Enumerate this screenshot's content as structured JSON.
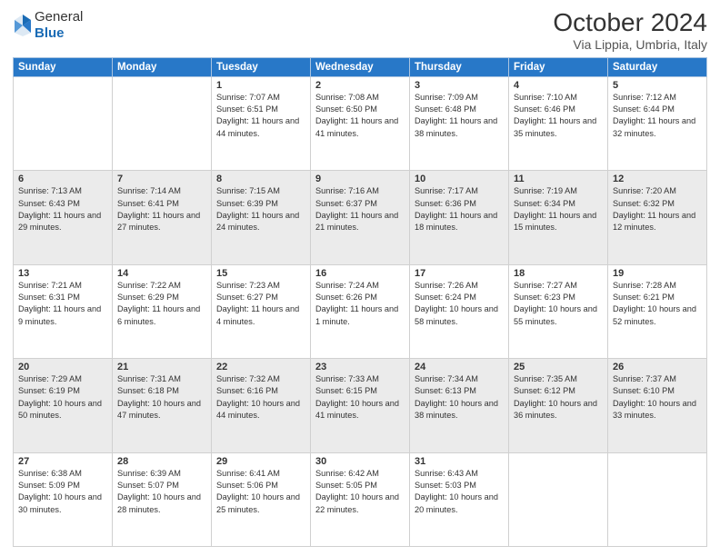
{
  "header": {
    "logo_general": "General",
    "logo_blue": "Blue",
    "title": "October 2024",
    "subtitle": "Via Lippia, Umbria, Italy"
  },
  "weekdays": [
    "Sunday",
    "Monday",
    "Tuesday",
    "Wednesday",
    "Thursday",
    "Friday",
    "Saturday"
  ],
  "weeks": [
    [
      {
        "day": "",
        "detail": ""
      },
      {
        "day": "",
        "detail": ""
      },
      {
        "day": "1",
        "detail": "Sunrise: 7:07 AM\nSunset: 6:51 PM\nDaylight: 11 hours and 44 minutes."
      },
      {
        "day": "2",
        "detail": "Sunrise: 7:08 AM\nSunset: 6:50 PM\nDaylight: 11 hours and 41 minutes."
      },
      {
        "day": "3",
        "detail": "Sunrise: 7:09 AM\nSunset: 6:48 PM\nDaylight: 11 hours and 38 minutes."
      },
      {
        "day": "4",
        "detail": "Sunrise: 7:10 AM\nSunset: 6:46 PM\nDaylight: 11 hours and 35 minutes."
      },
      {
        "day": "5",
        "detail": "Sunrise: 7:12 AM\nSunset: 6:44 PM\nDaylight: 11 hours and 32 minutes."
      }
    ],
    [
      {
        "day": "6",
        "detail": "Sunrise: 7:13 AM\nSunset: 6:43 PM\nDaylight: 11 hours and 29 minutes."
      },
      {
        "day": "7",
        "detail": "Sunrise: 7:14 AM\nSunset: 6:41 PM\nDaylight: 11 hours and 27 minutes."
      },
      {
        "day": "8",
        "detail": "Sunrise: 7:15 AM\nSunset: 6:39 PM\nDaylight: 11 hours and 24 minutes."
      },
      {
        "day": "9",
        "detail": "Sunrise: 7:16 AM\nSunset: 6:37 PM\nDaylight: 11 hours and 21 minutes."
      },
      {
        "day": "10",
        "detail": "Sunrise: 7:17 AM\nSunset: 6:36 PM\nDaylight: 11 hours and 18 minutes."
      },
      {
        "day": "11",
        "detail": "Sunrise: 7:19 AM\nSunset: 6:34 PM\nDaylight: 11 hours and 15 minutes."
      },
      {
        "day": "12",
        "detail": "Sunrise: 7:20 AM\nSunset: 6:32 PM\nDaylight: 11 hours and 12 minutes."
      }
    ],
    [
      {
        "day": "13",
        "detail": "Sunrise: 7:21 AM\nSunset: 6:31 PM\nDaylight: 11 hours and 9 minutes."
      },
      {
        "day": "14",
        "detail": "Sunrise: 7:22 AM\nSunset: 6:29 PM\nDaylight: 11 hours and 6 minutes."
      },
      {
        "day": "15",
        "detail": "Sunrise: 7:23 AM\nSunset: 6:27 PM\nDaylight: 11 hours and 4 minutes."
      },
      {
        "day": "16",
        "detail": "Sunrise: 7:24 AM\nSunset: 6:26 PM\nDaylight: 11 hours and 1 minute."
      },
      {
        "day": "17",
        "detail": "Sunrise: 7:26 AM\nSunset: 6:24 PM\nDaylight: 10 hours and 58 minutes."
      },
      {
        "day": "18",
        "detail": "Sunrise: 7:27 AM\nSunset: 6:23 PM\nDaylight: 10 hours and 55 minutes."
      },
      {
        "day": "19",
        "detail": "Sunrise: 7:28 AM\nSunset: 6:21 PM\nDaylight: 10 hours and 52 minutes."
      }
    ],
    [
      {
        "day": "20",
        "detail": "Sunrise: 7:29 AM\nSunset: 6:19 PM\nDaylight: 10 hours and 50 minutes."
      },
      {
        "day": "21",
        "detail": "Sunrise: 7:31 AM\nSunset: 6:18 PM\nDaylight: 10 hours and 47 minutes."
      },
      {
        "day": "22",
        "detail": "Sunrise: 7:32 AM\nSunset: 6:16 PM\nDaylight: 10 hours and 44 minutes."
      },
      {
        "day": "23",
        "detail": "Sunrise: 7:33 AM\nSunset: 6:15 PM\nDaylight: 10 hours and 41 minutes."
      },
      {
        "day": "24",
        "detail": "Sunrise: 7:34 AM\nSunset: 6:13 PM\nDaylight: 10 hours and 38 minutes."
      },
      {
        "day": "25",
        "detail": "Sunrise: 7:35 AM\nSunset: 6:12 PM\nDaylight: 10 hours and 36 minutes."
      },
      {
        "day": "26",
        "detail": "Sunrise: 7:37 AM\nSunset: 6:10 PM\nDaylight: 10 hours and 33 minutes."
      }
    ],
    [
      {
        "day": "27",
        "detail": "Sunrise: 6:38 AM\nSunset: 5:09 PM\nDaylight: 10 hours and 30 minutes."
      },
      {
        "day": "28",
        "detail": "Sunrise: 6:39 AM\nSunset: 5:07 PM\nDaylight: 10 hours and 28 minutes."
      },
      {
        "day": "29",
        "detail": "Sunrise: 6:41 AM\nSunset: 5:06 PM\nDaylight: 10 hours and 25 minutes."
      },
      {
        "day": "30",
        "detail": "Sunrise: 6:42 AM\nSunset: 5:05 PM\nDaylight: 10 hours and 22 minutes."
      },
      {
        "day": "31",
        "detail": "Sunrise: 6:43 AM\nSunset: 5:03 PM\nDaylight: 10 hours and 20 minutes."
      },
      {
        "day": "",
        "detail": ""
      },
      {
        "day": "",
        "detail": ""
      }
    ]
  ]
}
